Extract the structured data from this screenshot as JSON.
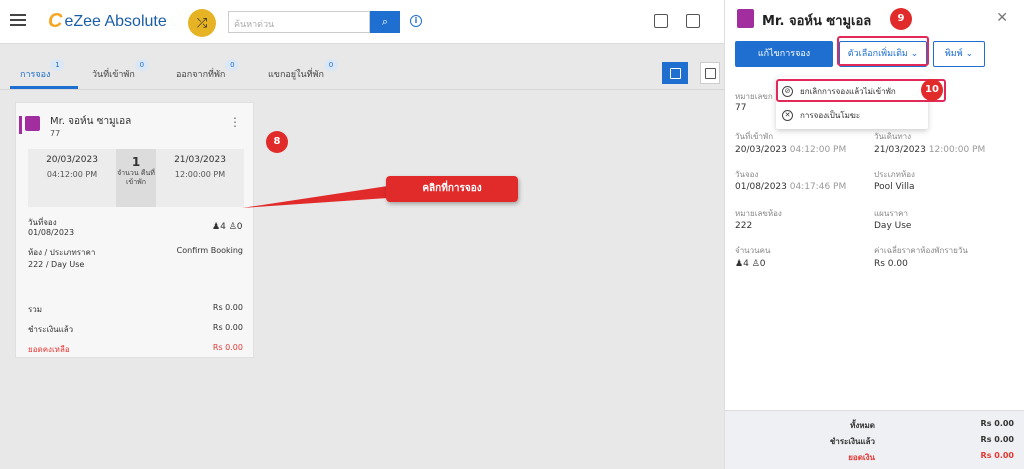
{
  "app": {
    "name": "eZee Absolute",
    "logo_letter": "C"
  },
  "search": {
    "placeholder": "ค้นหาด่วน"
  },
  "tabs": [
    {
      "label": "การจอง",
      "count": "1"
    },
    {
      "label": "วันที่เข้าพัก",
      "count": "0"
    },
    {
      "label": "ออกจากที่พัก",
      "count": "0"
    },
    {
      "label": "แขกอยู่ในที่พัก",
      "count": "0"
    }
  ],
  "card": {
    "guest_name": "Mr. จอห์น ซามูเอล",
    "reservation_no": "77",
    "arrival_date": "20/03/2023",
    "arrival_time": "04:12:00 PM",
    "nights": "1",
    "nights_label": "จำนวน คืนที่ เข้าพัก",
    "departure_date": "21/03/2023",
    "departure_time": "12:00:00 PM",
    "booking_date_label": "วันที่จอง",
    "booking_date": "01/08/2023",
    "adults": "4",
    "children": "0",
    "room_rate_label": "ห้อง / ประเภทราคา",
    "status": "Confirm Booking",
    "room_rate": "222 / Day Use",
    "total_label": "รวม",
    "total": "Rs 0.00",
    "paid_label": "ชำระเงินแล้ว",
    "paid": "Rs 0.00",
    "balance_label": "ยอดคงเหลือ",
    "balance": "Rs 0.00"
  },
  "annotations": {
    "callout": "คลิกที่การจอง",
    "marker_8": "8",
    "marker_9": "9",
    "marker_10": "10"
  },
  "panel": {
    "guest_name": "Mr. จอห์น ซามูเอล",
    "edit_button": "แก้ไขการจอง",
    "more_options": "ตัวเลือกเพิ่มเติม",
    "print": "พิมพ์",
    "dropdown": [
      {
        "label": "ยกเลิกการจองแล้วไม่เข้าพัก",
        "icon": "eye-slash-icon"
      },
      {
        "label": "การจองเป็นโมฆะ",
        "icon": "x-circle-icon"
      }
    ],
    "fields": {
      "res_no_label": "หมายเลขก",
      "res_no": "77",
      "arrival_label": "วันที่เข้าพัก",
      "arrival_date": "20/03/2023",
      "arrival_time": "04:12:00 PM",
      "departure_label": "วันเดินทาง",
      "departure_date": "21/03/2023",
      "departure_time": "12:00:00 PM",
      "booking_label": "วันจอง",
      "booking_date": "01/08/2023",
      "booking_time": "04:17:46 PM",
      "room_type_label": "ประเภทห้อง",
      "room_type": "Pool Villa",
      "room_no_label": "หมายเลขห้อง",
      "room_no": "222",
      "rate_plan_label": "แผนราคา",
      "rate_plan": "Day Use",
      "pax_label": "จำนวนคน",
      "adults": "4",
      "children": "0",
      "avg_rate_label": "ค่าเฉลี่ยราคาห้องพักรายวัน",
      "avg_rate": "Rs 0.00"
    },
    "footer": {
      "total_label": "ทั้งหมด",
      "total": "Rs 0.00",
      "paid_label": "ชำระเงินแล้ว",
      "paid": "Rs 0.00",
      "balance_label": "ยอดเงิน",
      "balance": "Rs 0.00"
    }
  },
  "colors": {
    "primary": "#1e6fcf",
    "accent": "#a12d9e",
    "alert": "#e12a2a"
  }
}
